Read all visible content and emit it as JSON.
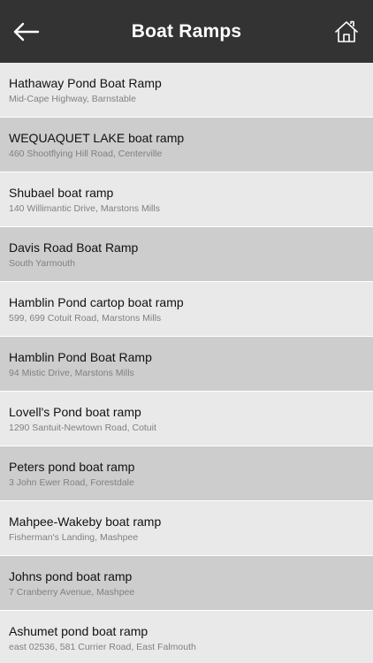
{
  "header": {
    "title": "Boat Ramps",
    "back_icon": "arrow-left-icon",
    "home_icon": "home-icon",
    "background": "#333333"
  },
  "ramps": [
    {
      "name": "Hathaway Pond Boat Ramp",
      "address": "Mid-Cape Highway, Barnstable"
    },
    {
      "name": "WEQUAQUET LAKE boat ramp",
      "address": "460 Shootflying Hill Road, Centerville"
    },
    {
      "name": "Shubael boat ramp",
      "address": "140 Willimantic Drive, Marstons Mills"
    },
    {
      "name": "Davis Road Boat Ramp",
      "address": "South Yarmouth"
    },
    {
      "name": "Hamblin Pond cartop boat ramp",
      "address": "599, 699 Cotuit Road, Marstons Mills"
    },
    {
      "name": "Hamblin Pond Boat Ramp",
      "address": "94 Mistic Drive, Marstons Mills"
    },
    {
      "name": "Lovell's Pond boat ramp",
      "address": "1290 Santuit-Newtown Road, Cotuit"
    },
    {
      "name": "Peters pond boat ramp",
      "address": "3 John Ewer Road, Forestdale"
    },
    {
      "name": "Mahpee-Wakeby boat ramp",
      "address": "Fisherman's Landing, Mashpee"
    },
    {
      "name": "Johns pond boat ramp",
      "address": "7 Cranberry Avenue, Mashpee"
    },
    {
      "name": "Ashumet pond boat ramp",
      "address": "east 02536, 581 Currier Road, East Falmouth"
    }
  ],
  "colors": {
    "row_light": "#e9e9e9",
    "row_dark": "#cdcdcd"
  }
}
